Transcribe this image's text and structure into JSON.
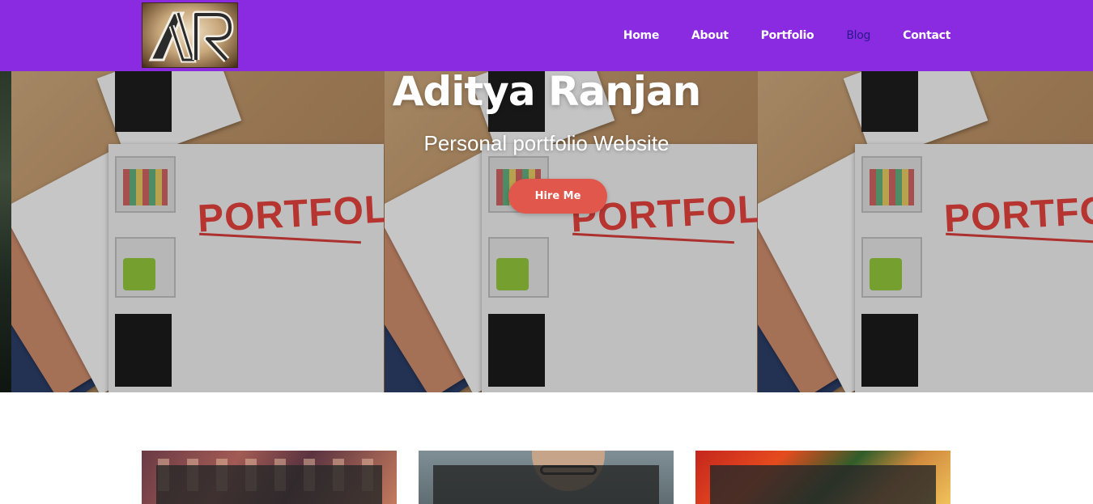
{
  "navbar": {
    "logo_text": "AR",
    "links": [
      {
        "label": "Home"
      },
      {
        "label": "About"
      },
      {
        "label": "Portfolio"
      },
      {
        "label": "Blog"
      },
      {
        "label": "Contact"
      }
    ],
    "active_link": "Blog",
    "background_color": "#8a2be2",
    "active_color": "#2a1a8c"
  },
  "hero": {
    "title": "Aditya Ranjan",
    "subtitle": "Personal portfolio Website",
    "cta_label": "Hire Me",
    "cta_color": "#e2574c",
    "background_word": "PORTFOLIO",
    "background_word_color": "#e0413c"
  },
  "cards": [
    {
      "image": "crowd-photo"
    },
    {
      "image": "man-with-glasses-photo"
    },
    {
      "image": "food-photo"
    }
  ]
}
